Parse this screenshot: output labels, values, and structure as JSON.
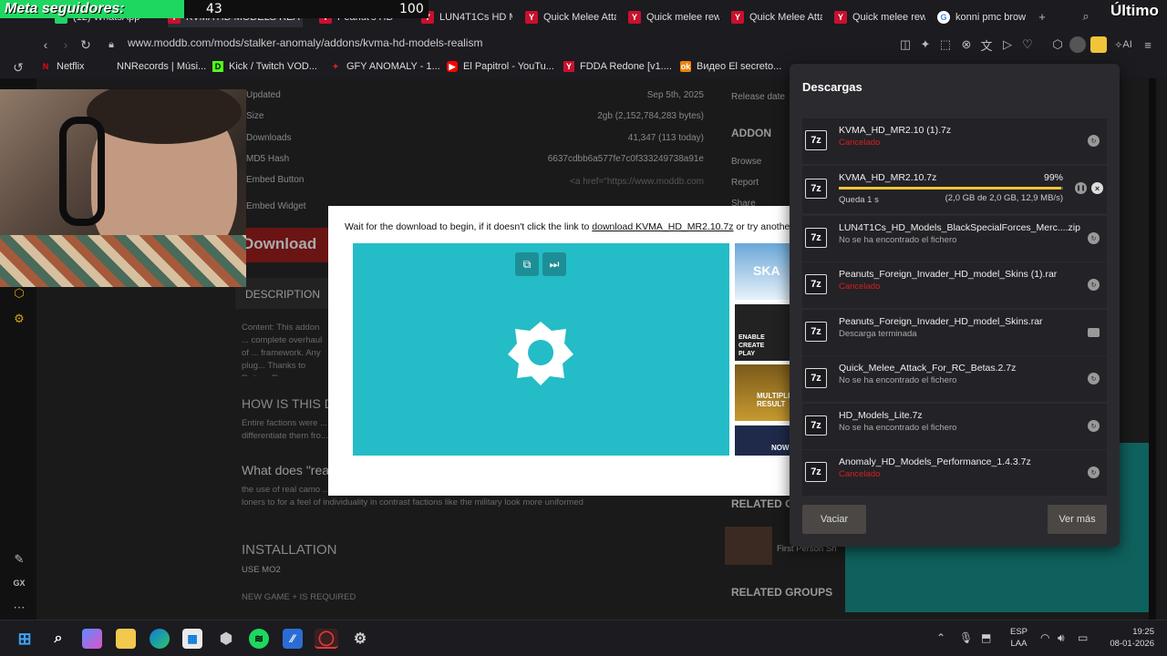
{
  "overlay": {
    "goal_label": "Meta seguidores:",
    "goal_current": "43",
    "goal_max": "100",
    "goal_fraction": 0.43,
    "recent_label": "Último"
  },
  "tabs": [
    {
      "label": "(12) WhatsApp",
      "icon": "whatsapp-icon"
    },
    {
      "label": "KVMA HD MODELS REA",
      "icon": "moddb-icon"
    },
    {
      "label": "Peanut's HD",
      "icon": "moddb-icon"
    },
    {
      "label": "LUN4T1Cs HD M",
      "icon": "moddb-icon"
    },
    {
      "label": "Quick Melee Atta",
      "icon": "moddb-icon"
    },
    {
      "label": "Quick melee rew",
      "icon": "moddb-icon"
    },
    {
      "label": "Quick Melee Atta",
      "icon": "moddb-icon"
    },
    {
      "label": "Quick melee rew",
      "icon": "moddb-icon"
    },
    {
      "label": "konni pmc brow",
      "icon": "google-icon"
    }
  ],
  "address": {
    "url": "www.moddb.com/mods/stalker-anomaly/addons/kvma-hd-models-realism"
  },
  "bookmarks": [
    {
      "label": "Netflix",
      "icon": "netflix-icon",
      "color": "#e50914"
    },
    {
      "label": "NNRecords | Músi...",
      "icon": "music-icon",
      "color": "#cccccc"
    },
    {
      "label": "Kick / Twitch VOD...",
      "icon": "kick-icon",
      "color": "#53fc18"
    },
    {
      "label": "GFY ANOMALY - 1...",
      "icon": "gfy-icon",
      "color": "#cc2222"
    },
    {
      "label": "El Papitrol - YouTu...",
      "icon": "youtube-icon",
      "color": "#ff0000"
    },
    {
      "label": "FDDA Redone [v1....",
      "icon": "moddb-icon",
      "color": "#c8102e"
    },
    {
      "label": "Видео El secreto...",
      "icon": "ok-icon",
      "color": "#ee8208"
    }
  ],
  "page": {
    "updated_label": "Updated",
    "updated_value": "Sep 5th, 2025",
    "size_label": "Size",
    "size_value": "2gb (2,152,784,283 bytes)",
    "downloads_label": "Downloads",
    "downloads_value": "41,347 (113 today)",
    "md5_label": "MD5 Hash",
    "md5_value": "6637cdbb6a577fe7c0f333249738a91e",
    "embed_button_label": "Embed Button",
    "embed_button_value": "<a href=\"https://www.moddb.com",
    "embed_widget_label": "Embed Widget",
    "release_date_label": "Release date",
    "addon_heading": "ADDON",
    "addon_links": [
      "Browse",
      "Report",
      "Share"
    ],
    "download_button": "Download",
    "description_tab": "DESCRIPTION",
    "description_text": "Content: This addon ... complete overhaul of ... framework. Any plug... Thanks to Raito-x-Ra...",
    "how_heading": "HOW IS THIS D",
    "how_text": "Entire factions were ... differentiate them fro...",
    "what_heading": "What does \"rea",
    "what_text": "the use of real camo ... NATO gear, there are more unique models among decentralized factions such as bandits and loners to for a feel of individuality in contrast factions like the military look more uniformed",
    "installation_heading": "INSTALLATION",
    "use_mo2": "USE MO2",
    "new_game": "NEW GAME + IS REQUIRED",
    "related_content": "RELATED CO",
    "related_item": "First Person Sh",
    "related_groups": "RELATED GROUPS"
  },
  "modal": {
    "text_before": "Wait for the download to begin, if it doesn't click the link to ",
    "link_text": "download KVMA_HD_MR2.10.7z",
    "text_after": " or try another m",
    "thumbs": [
      "SKA",
      "ENABLE CREATE PLAY",
      "MULTIPLE RESULT",
      "NOW"
    ]
  },
  "downloads": {
    "title": "Descargas",
    "items": [
      {
        "name": "KVMA_HD_MR2.10 (1).7z",
        "status": "Cancelado",
        "state": "cancelled",
        "action": "retry-icon"
      },
      {
        "name": "KVMA_HD_MR2.10.7z",
        "status": "Queda 1 s",
        "state": "active",
        "percent": "99%",
        "progress": 0.99,
        "size": "(2,0 GB de 2,0 GB, 12,9 MB/s)"
      },
      {
        "name": "LUN4T1Cs_HD_Models_BlackSpecialForces_Merc....zip",
        "status": "No se ha encontrado el fichero",
        "state": "missing",
        "action": "retry-icon"
      },
      {
        "name": "Peanuts_Foreign_Invader_HD_model_Skins (1).rar",
        "status": "Cancelado",
        "state": "cancelled",
        "action": "retry-icon"
      },
      {
        "name": "Peanuts_Foreign_Invader_HD_model_Skins.rar",
        "status": "Descarga terminada",
        "state": "done",
        "action": "folder-icon"
      },
      {
        "name": "Quick_Melee_Attack_For_RC_Betas.2.7z",
        "status": "No se ha encontrado el fichero",
        "state": "missing",
        "action": "retry-icon"
      },
      {
        "name": "HD_Models_Lite.7z",
        "status": "No se ha encontrado el fichero",
        "state": "missing",
        "action": "retry-icon"
      },
      {
        "name": "Anomaly_HD_Models_Performance_1.4.3.7z",
        "status": "Cancelado",
        "state": "cancelled",
        "action": "retry-icon"
      }
    ],
    "file_icon_text": "7z",
    "clear_button": "Vaciar",
    "more_button": "Ver más"
  },
  "sidebar": {
    "gx_label": "GX"
  },
  "toolbar": {
    "ai_label": "AI"
  },
  "taskbar": {
    "lang_1": "ESP",
    "lang_2": "LAA",
    "time": "19:25",
    "date": "08-01-2026"
  },
  "colors": {
    "accent": "#f0c53a",
    "cancel": "#d02020",
    "goal_fill": "#1ed760"
  }
}
